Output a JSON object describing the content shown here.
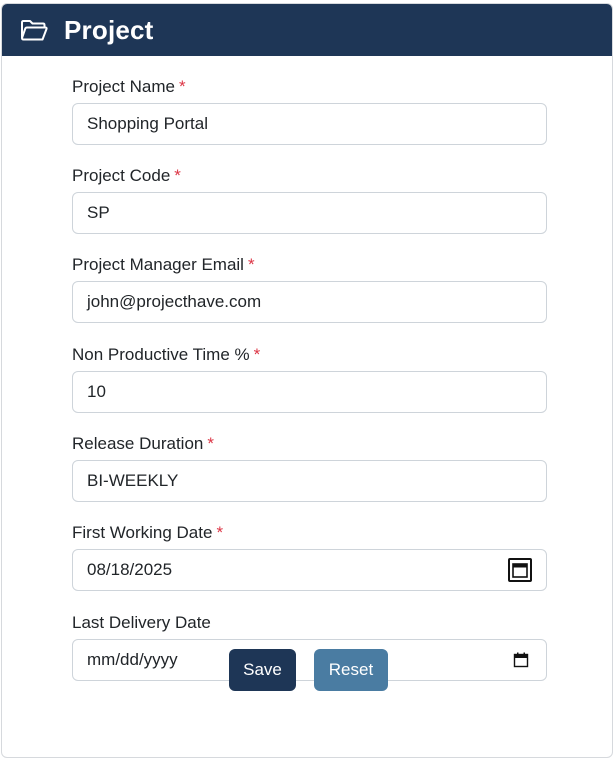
{
  "header": {
    "title": "Project",
    "icon": "folder-open-icon"
  },
  "form": {
    "project_name": {
      "label": "Project Name",
      "required_mark": "*",
      "value": "Shopping Portal"
    },
    "project_code": {
      "label": "Project Code",
      "required_mark": "*",
      "value": "SP"
    },
    "manager_email": {
      "label": "Project Manager Email",
      "required_mark": "*",
      "value": "john@projecthave.com"
    },
    "non_productive_time": {
      "label": "Non Productive Time %",
      "required_mark": "*",
      "value": "10"
    },
    "release_duration": {
      "label": "Release Duration",
      "required_mark": "*",
      "value": "BI-WEEKLY"
    },
    "first_working_date": {
      "label": "First Working Date",
      "required_mark": "*",
      "value": "08/18/2025"
    },
    "last_delivery_date": {
      "label": "Last Delivery Date",
      "value": "",
      "placeholder": "mm/dd/yyyy"
    }
  },
  "actions": {
    "save_label": "Save",
    "reset_label": "Reset"
  },
  "colors": {
    "header_bg": "#1e3656",
    "required": "#dc3545",
    "save_bg": "#1e3656",
    "reset_bg": "#4a7ca2"
  }
}
